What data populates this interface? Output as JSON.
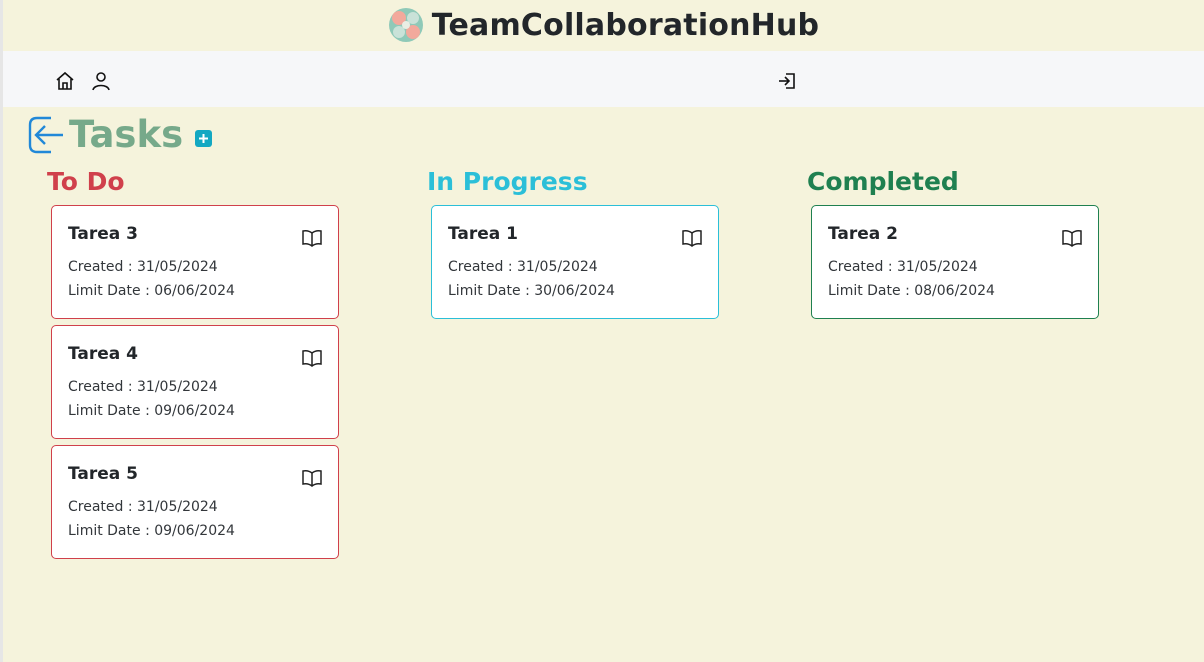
{
  "app": {
    "title": "TeamCollaborationHub"
  },
  "page": {
    "title": "Tasks"
  },
  "colors": {
    "todo": "#d0404b",
    "in_progress": "#2bbfd8",
    "completed": "#1f8050",
    "title_green": "#76a98a"
  },
  "columns": [
    {
      "title": "To Do",
      "tasks": [
        {
          "name": "Tarea 3",
          "created": "Created : 31/05/2024",
          "limit": "Limit Date : 06/06/2024"
        },
        {
          "name": "Tarea 4",
          "created": "Created : 31/05/2024",
          "limit": "Limit Date : 09/06/2024"
        },
        {
          "name": "Tarea 5",
          "created": "Created : 31/05/2024",
          "limit": "Limit Date : 09/06/2024"
        }
      ]
    },
    {
      "title": "In Progress",
      "tasks": [
        {
          "name": "Tarea 1",
          "created": "Created : 31/05/2024",
          "limit": "Limit Date : 30/06/2024"
        }
      ]
    },
    {
      "title": "Completed",
      "tasks": [
        {
          "name": "Tarea 2",
          "created": "Created : 31/05/2024",
          "limit": "Limit Date : 08/06/2024"
        }
      ]
    }
  ],
  "icons": {
    "logo": "logo-image",
    "home": "home-icon",
    "user": "user-icon",
    "login": "login-icon",
    "back": "back-arrow-icon",
    "add": "add-icon",
    "view": "book-icon"
  }
}
